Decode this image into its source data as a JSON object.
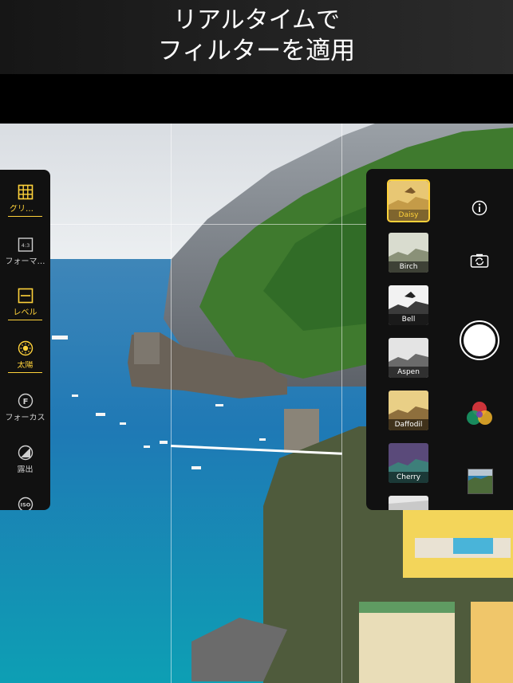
{
  "header": {
    "line1": "リアルタイムで",
    "line2": "フィルターを適用"
  },
  "left_toolbar": {
    "items": [
      {
        "label": "グリッド",
        "icon": "grid-icon",
        "active": true
      },
      {
        "label": "フォーマ…",
        "icon": "format-4-3-icon",
        "active": false
      },
      {
        "label": "レベル",
        "icon": "level-icon",
        "active": true
      },
      {
        "label": "太陽",
        "icon": "sun-icon",
        "active": true
      },
      {
        "label": "フォーカス",
        "icon": "focus-f-icon",
        "active": false
      },
      {
        "label": "露出",
        "icon": "exposure-icon",
        "active": false
      },
      {
        "label": "",
        "icon": "iso-icon",
        "active": false
      }
    ]
  },
  "filters": {
    "items": [
      {
        "name": "Daisy",
        "selected": true
      },
      {
        "name": "Birch",
        "selected": false
      },
      {
        "name": "Bell",
        "selected": false
      },
      {
        "name": "Aspen",
        "selected": false
      },
      {
        "name": "Daffodil",
        "selected": false
      },
      {
        "name": "Cherry",
        "selected": false
      }
    ]
  },
  "right_controls": {
    "info_icon": "info-icon",
    "switch_camera_icon": "switch-camera-icon",
    "shutter_icon": "shutter-button",
    "color_filter_icon": "color-filter-icon",
    "gallery_icon": "gallery-thumbnail"
  },
  "colors": {
    "accent": "#ffd23a",
    "panel": "#111111"
  }
}
